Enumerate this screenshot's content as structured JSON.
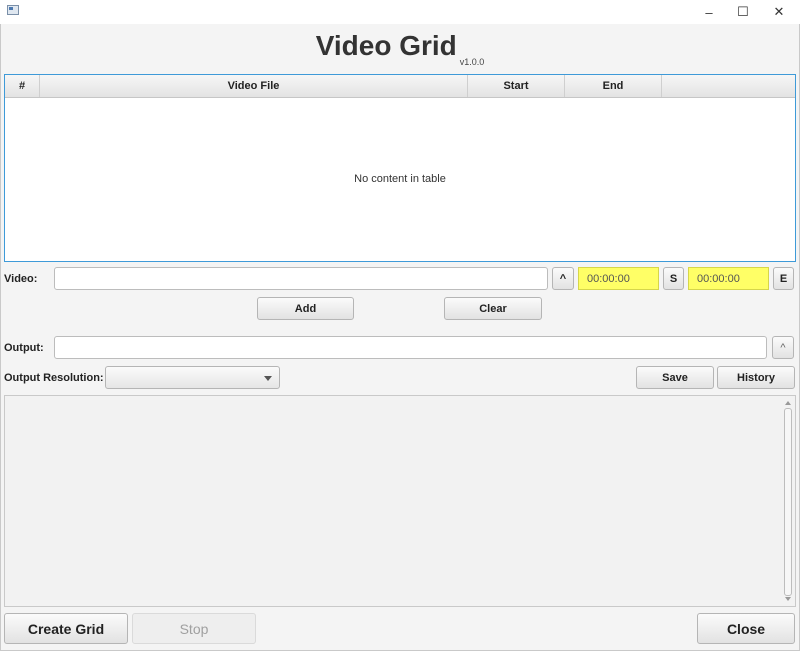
{
  "window": {
    "minimize_glyph": "–",
    "maximize_glyph": "☐",
    "close_glyph": "✕"
  },
  "header": {
    "title": "Video Grid",
    "version": "v1.0.0"
  },
  "table": {
    "columns": [
      "#",
      "Video File",
      "Start",
      "End",
      ""
    ],
    "empty_message": "No content in table"
  },
  "video": {
    "label": "Video:",
    "value": "",
    "browse_label": "^",
    "start_time": "00:00:00",
    "start_button": "S",
    "end_time": "00:00:00",
    "end_button": "E"
  },
  "actions": {
    "add": "Add",
    "clear": "Clear"
  },
  "output": {
    "label": "Output:",
    "value": "",
    "browse_label": "^",
    "resolution_label": "Output Resolution:",
    "resolution_value": "",
    "save": "Save",
    "history": "History"
  },
  "log": {
    "text": ""
  },
  "footer": {
    "create_grid": "Create Grid",
    "stop": "Stop",
    "close": "Close"
  },
  "colors": {
    "table_border": "#3e9ad8",
    "time_field_bg": "#ffff66"
  }
}
